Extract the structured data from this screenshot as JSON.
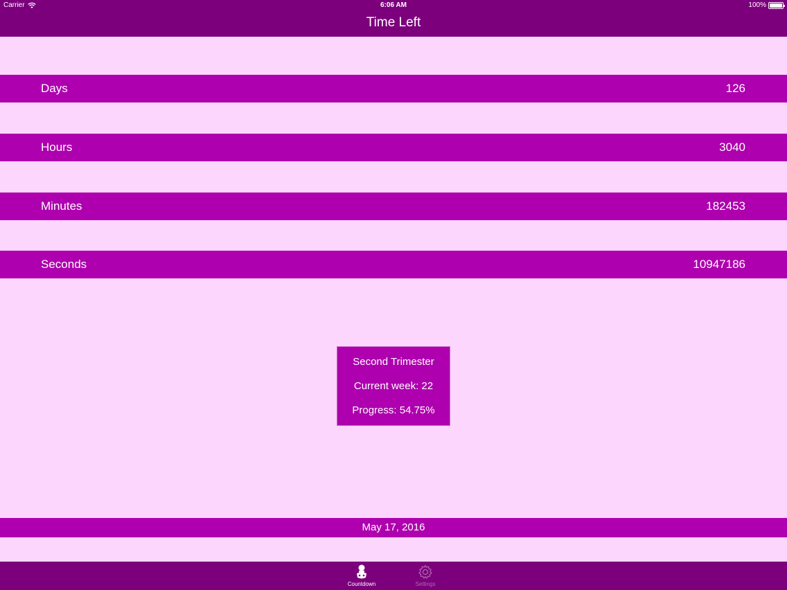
{
  "status_bar": {
    "carrier": "Carrier",
    "time": "6:06 AM",
    "battery": "100%"
  },
  "nav": {
    "title": "Time Left"
  },
  "rows": [
    {
      "label": "Days",
      "value": "126"
    },
    {
      "label": "Hours",
      "value": "3040"
    },
    {
      "label": "Minutes",
      "value": "182453"
    },
    {
      "label": "Seconds",
      "value": "10947186"
    }
  ],
  "info": {
    "trimester": "Second Trimester",
    "current_week": "Current week: 22",
    "progress": "Progress: 54.75%"
  },
  "due_date": "May 17, 2016",
  "tabs": [
    {
      "label": "Countdown",
      "icon": "baby-icon",
      "active": true
    },
    {
      "label": "Settings",
      "icon": "gear-icon",
      "active": false
    }
  ],
  "colors": {
    "background": "#fdd6fd",
    "bar_dark": "#7c007c",
    "row": "#ae00ae"
  }
}
